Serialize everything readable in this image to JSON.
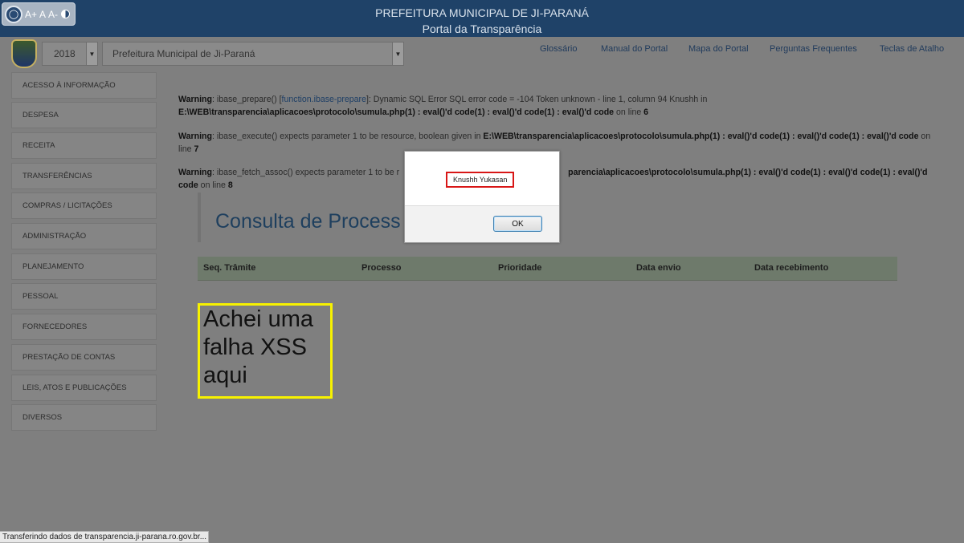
{
  "header": {
    "accessibility": {
      "increase": "A+",
      "normal": "A",
      "decrease": "A-"
    },
    "title": "PREFEITURA MUNICIPAL DE JI-PARANÁ",
    "subtitle": "Portal da Transparência"
  },
  "filters": {
    "year": "2018",
    "organization": "Prefeitura Municipal de Ji-Paraná"
  },
  "top_links": [
    "Glossário",
    "Manual do Portal",
    "Mapa do Portal",
    "Perguntas Frequentes",
    "Teclas de Atalho"
  ],
  "sidebar": {
    "items": [
      "ACESSO À INFORMAÇÃO",
      "DESPESA",
      "RECEITA",
      "TRANSFERÊNCIAS",
      "COMPRAS / LICITAÇÕES",
      "ADMINISTRAÇÃO",
      "PLANEJAMENTO",
      "PESSOAL",
      "FORNECEDORES",
      "PRESTAÇÃO DE CONTAS",
      "LEIS, ATOS E PUBLICAÇÕES",
      "DIVERSOS"
    ]
  },
  "warnings": {
    "w1": {
      "label": "Warning",
      "pre": ": ibase_prepare() [",
      "link": "function.ibase-prepare",
      "msg": "]: Dynamic SQL Error SQL error code = -104 Token unknown - line 1, column 94 Knushh in ",
      "file": "E:\\WEB\\transparencia\\aplicacoes\\protocolo\\sumula.php(1) : eval()'d code(1) : eval()'d code(1) : eval()'d code",
      "on_line": " on line ",
      "line": "6"
    },
    "w2": {
      "label": "Warning",
      "msg": ": ibase_execute() expects parameter 1 to be resource, boolean given in ",
      "file": "E:\\WEB\\transparencia\\aplicacoes\\protocolo\\sumula.php(1) : eval()'d code(1) : eval()'d code(1) : eval()'d code",
      "on_line": " on line ",
      "line": "7"
    },
    "w3": {
      "label": "Warning",
      "msg": ": ibase_fetch_assoc() expects parameter 1 to be r",
      "file": "parencia\\aplicacoes\\protocolo\\sumula.php(1) : eval()'d code(1) : eval()'d code(1) : eval()'d code",
      "on_line": " on line ",
      "line": "8"
    }
  },
  "main": {
    "heading": "Consulta de Process",
    "table_headers": [
      "Seq. Trâmite",
      "Processo",
      "Prioridade",
      "Data envio",
      "Data recebimento"
    ],
    "annotation": "Achei uma falha XSS aqui"
  },
  "dialog": {
    "message": "Knushh Yukasan",
    "ok_label": "OK"
  },
  "status_bar": "Transferindo dados de transparencia.ji-parana.ro.gov.br..."
}
